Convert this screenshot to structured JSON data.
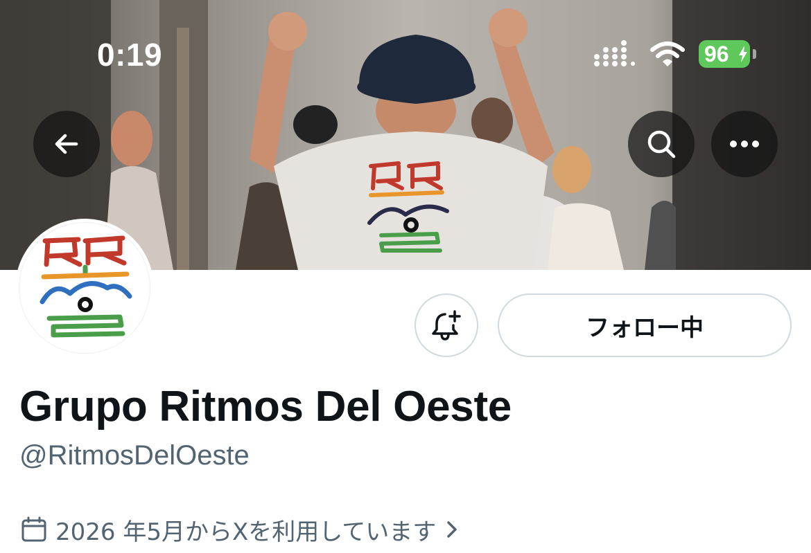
{
  "status_bar": {
    "time": "0:19",
    "battery_level": "96"
  },
  "header": {
    "back_icon": "arrow-left-icon",
    "search_icon": "search-icon",
    "more_icon": "more-horizontal-icon"
  },
  "profile": {
    "display_name": "Grupo Ritmos Del Oeste",
    "handle": "@RitmosDelOeste",
    "follow_button_label": "フォロー中",
    "notify_icon": "bell-plus-icon",
    "joined_text": "2026 年5月からXを利用しています",
    "joined_icon": "calendar-icon",
    "joined_chevron_icon": "chevron-right-icon"
  },
  "colors": {
    "text_primary": "#0f1419",
    "text_secondary": "#536471",
    "button_border": "#cfd9de",
    "battery_green": "#5fc85a",
    "logo_red": "#c0392b",
    "logo_orange": "#e8952a",
    "logo_blue": "#2f6fc0",
    "logo_green": "#4a9e4a"
  }
}
